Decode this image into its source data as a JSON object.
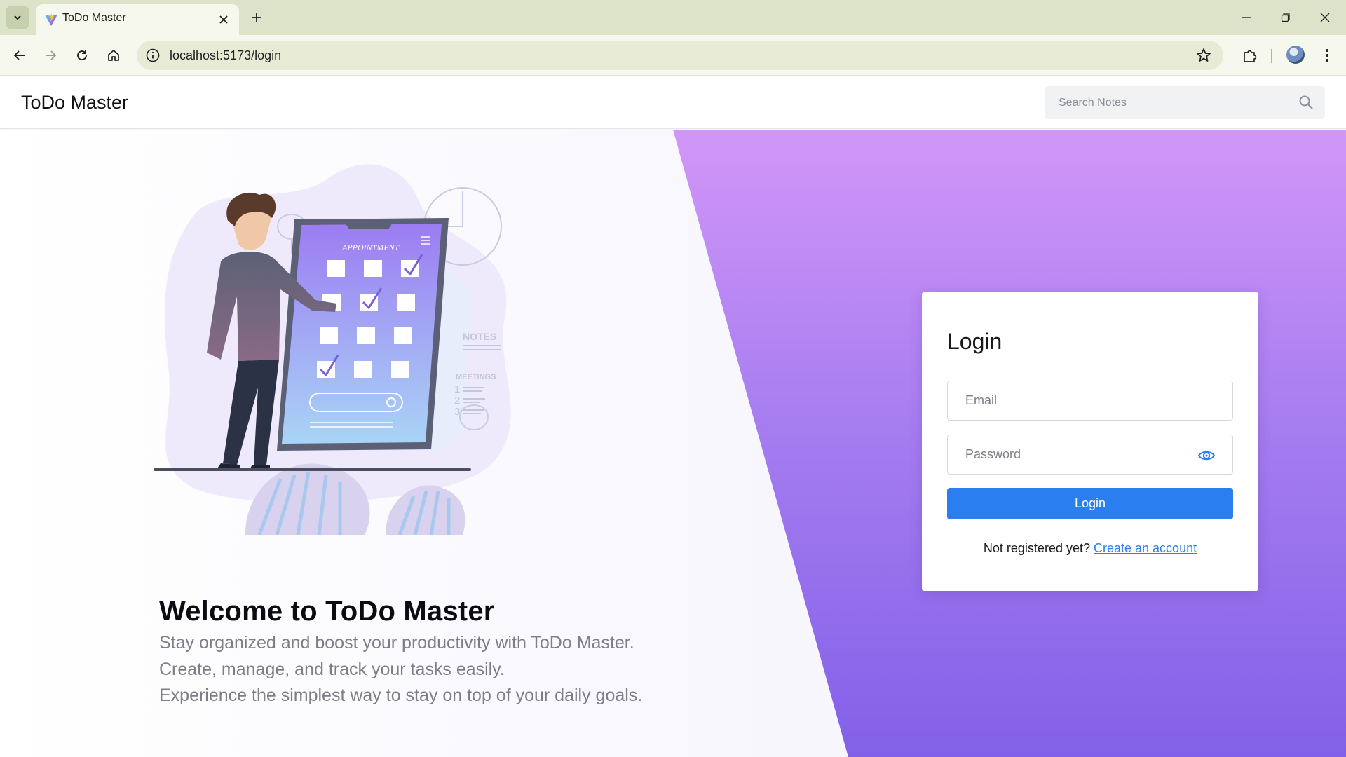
{
  "browser": {
    "tab_title": "ToDo Master",
    "url": "localhost:5173/login",
    "icons": {
      "tab_dropdown": "chevron-down-icon",
      "favicon": "vite-icon",
      "tab_close": "close-icon",
      "new_tab": "plus-icon",
      "back": "arrow-left-icon",
      "forward": "arrow-right-icon",
      "reload": "reload-icon",
      "home": "home-icon",
      "site_info": "info-icon",
      "bookmark": "star-icon",
      "extensions": "puzzle-icon",
      "profile": "avatar",
      "menu": "kebab-icon",
      "minimize": "minimize-icon",
      "restore": "restore-icon",
      "close_window": "close-icon"
    }
  },
  "header": {
    "brand": "ToDo Master",
    "search_placeholder": "Search Notes"
  },
  "hero": {
    "title": "Welcome to ToDo Master",
    "lines": [
      "Stay organized and boost your productivity with ToDo Master.",
      "Create, manage, and track your tasks easily.",
      "Experience the simplest way to stay on top of your daily goals."
    ],
    "illustration_text": {
      "appointment": "APPOINTMENT",
      "notes": "NOTES",
      "meetings": "MEETINGS",
      "numbers": [
        "1",
        "2",
        "3"
      ]
    }
  },
  "login": {
    "title": "Login",
    "email_placeholder": "Email",
    "password_placeholder": "Password",
    "button_label": "Login",
    "register_prompt": "Not registered yet?",
    "register_link": "Create an account"
  },
  "colors": {
    "primary": "#2b7ef0",
    "panel_top": "#d296f8",
    "panel_bottom": "#8260e8"
  }
}
